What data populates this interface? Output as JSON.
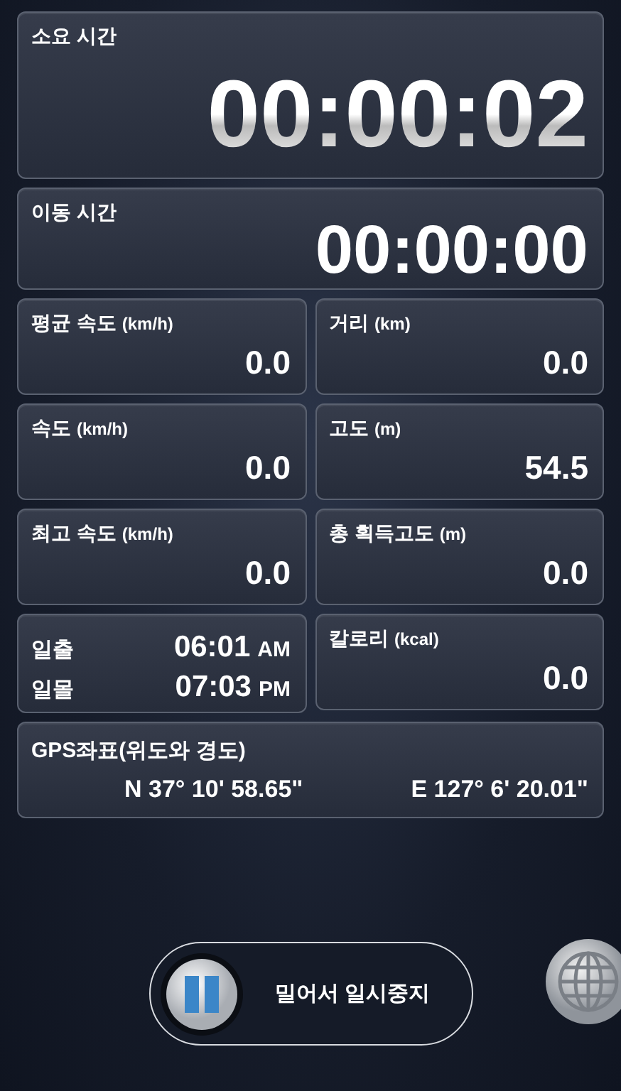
{
  "timers": [
    {
      "label": "소요 시간",
      "value": "00:00:02",
      "kind": "large"
    },
    {
      "label": "이동 시간",
      "value": "00:00:00",
      "kind": "medium"
    }
  ],
  "cells": [
    {
      "kind": "stat",
      "label": "평균 속도",
      "unit": "(km/h)",
      "value": "0.0"
    },
    {
      "kind": "stat",
      "label": "거리",
      "unit": "(km)",
      "value": "0.0"
    },
    {
      "kind": "stat",
      "label": "속도",
      "unit": "(km/h)",
      "value": "0.0"
    },
    {
      "kind": "stat",
      "label": "고도",
      "unit": "(m)",
      "value": "54.5"
    },
    {
      "kind": "stat",
      "label": "최고 속도",
      "unit": "(km/h)",
      "value": "0.0"
    },
    {
      "kind": "stat",
      "label": "총 획득고도",
      "unit": "(m)",
      "value": "0.0"
    },
    {
      "kind": "sun",
      "rows": [
        {
          "label": "일출",
          "time": "06:01",
          "period": "AM"
        },
        {
          "label": "일몰",
          "time": "07:03",
          "period": "PM"
        }
      ]
    },
    {
      "kind": "stat",
      "label": "칼로리",
      "unit": "(kcal)",
      "value": "0.0"
    }
  ],
  "gps": {
    "label": "GPS좌표(위도와 경도)",
    "latitude": "N 37° 10' 58.65\"",
    "longitude": "E 127° 6' 20.01\""
  },
  "slider": {
    "label": "밀어서 일시중지",
    "level": 0
  }
}
